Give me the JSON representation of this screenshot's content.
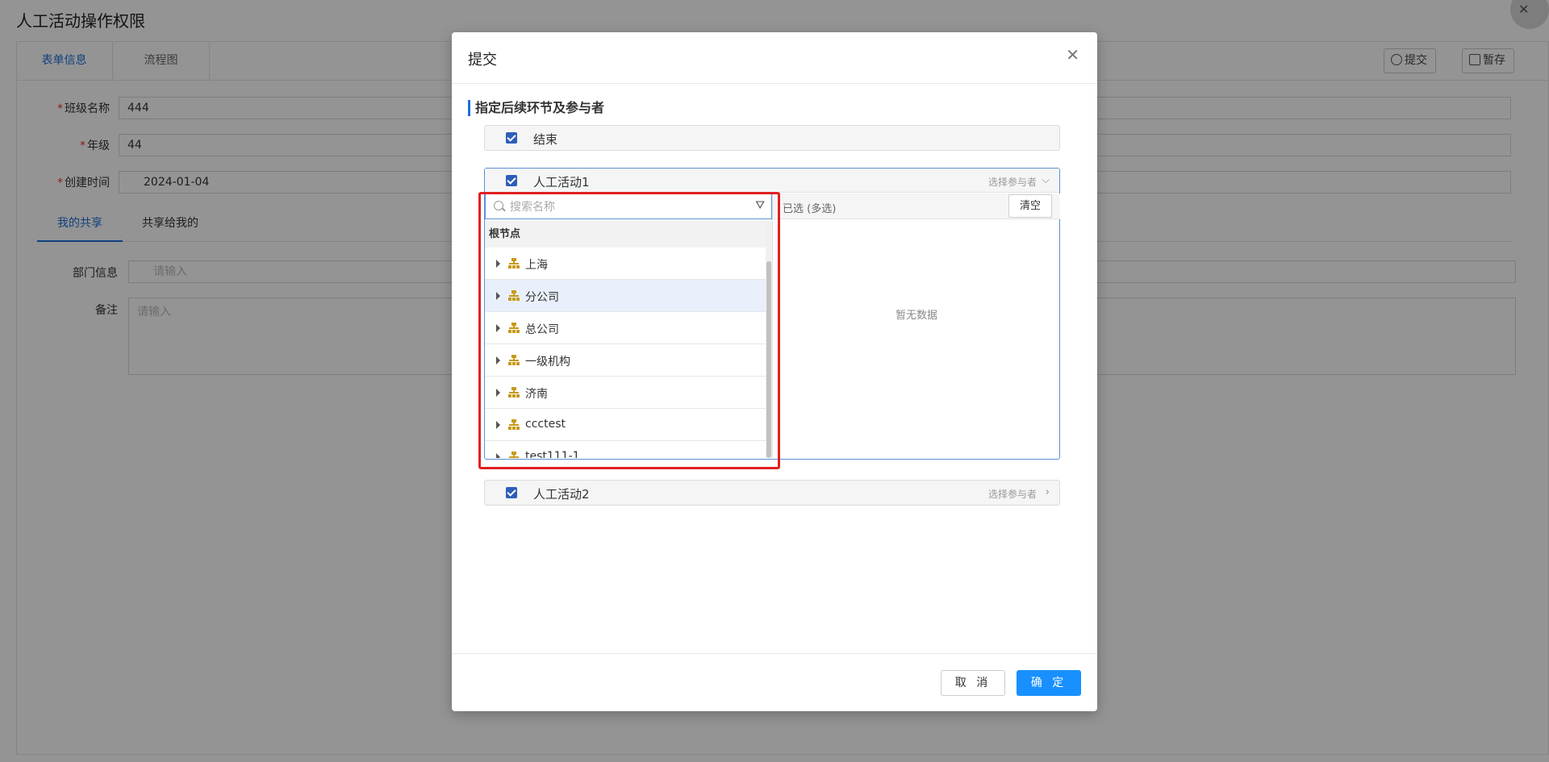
{
  "page": {
    "title": "人工活动操作权限",
    "tabs": [
      "表单信息",
      "流程图"
    ],
    "submit_label": "提交",
    "save_label": "暂存",
    "fields": {
      "class_name_label": "班级名称",
      "class_name_value": "444",
      "grade_label": "年级",
      "grade_value": "44",
      "created_label": "创建时间",
      "created_value": "2024-01-04"
    },
    "sub_tabs": [
      "我的共享",
      "共享给我的"
    ],
    "dept_label": "部门信息",
    "dept_placeholder": "请输入",
    "remark_label": "备注",
    "remark_placeholder": "请输入"
  },
  "modal": {
    "title": "提交",
    "section_title": "指定后续环节及参与者",
    "steps": [
      {
        "name": "结束"
      },
      {
        "name": "人工活动1",
        "select_label": "选择参与者"
      },
      {
        "name": "人工活动2",
        "select_label": "选择参与者"
      }
    ],
    "search_placeholder": "搜索名称",
    "tree_root": "根节点",
    "tree_items": [
      "上海",
      "分公司",
      "总公司",
      "一级机构",
      "济南",
      "ccctest",
      "test111-1"
    ],
    "selected_title": "已选 (多选)",
    "clear_label": "清空",
    "empty_text": "暂无数据",
    "cancel_label": "取 消",
    "ok_label": "确 定"
  },
  "colors": {
    "accent": "#1e6fd9",
    "primary_button": "#1890ff",
    "highlight": "#e02020",
    "org_icon": "#c79a18"
  }
}
